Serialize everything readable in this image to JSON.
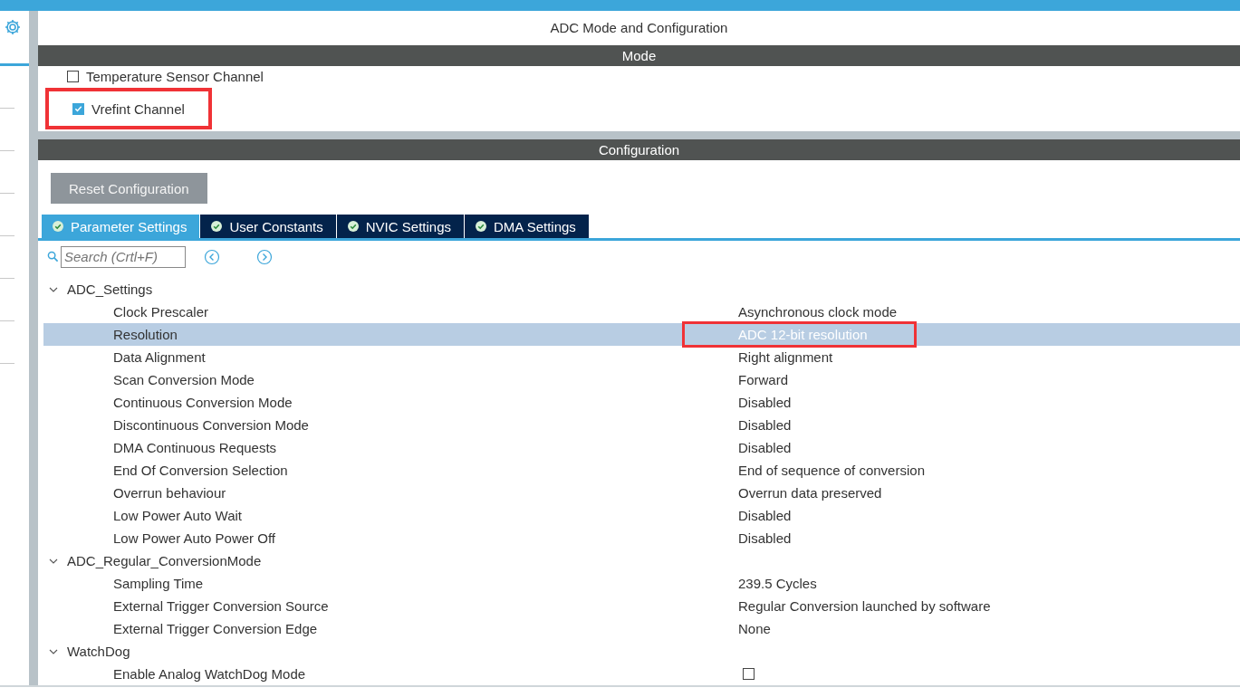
{
  "panel": {
    "title": "ADC Mode and Configuration"
  },
  "mode": {
    "header": "Mode",
    "channels": [
      {
        "label": "Temperature Sensor Channel",
        "checked": false
      },
      {
        "label": "Vrefint Channel",
        "checked": true,
        "highlighted": true
      }
    ]
  },
  "configuration": {
    "header": "Configuration",
    "reset_button": "Reset Configuration",
    "tabs": [
      {
        "label": "Parameter Settings",
        "selected": true
      },
      {
        "label": "User Constants",
        "selected": false
      },
      {
        "label": "NVIC Settings",
        "selected": false
      },
      {
        "label": "DMA Settings",
        "selected": false
      }
    ],
    "search": {
      "placeholder": "Search (Crtl+F)"
    },
    "tree": [
      {
        "label": "ADC_Settings",
        "expanded": true,
        "children": [
          {
            "label": "Clock Prescaler",
            "kind": "text",
            "value": "Asynchronous clock mode",
            "selected": false
          },
          {
            "label": "Resolution",
            "kind": "text",
            "value": "ADC 12-bit resolution",
            "selected": true,
            "highlighted": true
          },
          {
            "label": "Data Alignment",
            "kind": "text",
            "value": "Right alignment",
            "selected": false
          },
          {
            "label": "Scan Conversion Mode",
            "kind": "text",
            "value": "Forward",
            "selected": false
          },
          {
            "label": "Continuous Conversion Mode",
            "kind": "text",
            "value": "Disabled",
            "selected": false
          },
          {
            "label": "Discontinuous Conversion Mode",
            "kind": "text",
            "value": "Disabled",
            "selected": false
          },
          {
            "label": "DMA Continuous Requests",
            "kind": "text",
            "value": "Disabled",
            "selected": false
          },
          {
            "label": "End Of Conversion Selection",
            "kind": "text",
            "value": "End of sequence of conversion",
            "selected": false
          },
          {
            "label": "Overrun behaviour",
            "kind": "text",
            "value": "Overrun data preserved",
            "selected": false
          },
          {
            "label": "Low Power Auto Wait",
            "kind": "text",
            "value": "Disabled",
            "selected": false
          },
          {
            "label": "Low Power Auto Power Off",
            "kind": "text",
            "value": "Disabled",
            "selected": false
          }
        ]
      },
      {
        "label": "ADC_Regular_ConversionMode",
        "expanded": true,
        "children": [
          {
            "label": "Sampling Time",
            "kind": "text",
            "value": "239.5 Cycles",
            "selected": false
          },
          {
            "label": "External Trigger Conversion Source",
            "kind": "text",
            "value": "Regular Conversion launched by software",
            "selected": false
          },
          {
            "label": "External Trigger Conversion Edge",
            "kind": "text",
            "value": "None",
            "selected": false
          }
        ]
      },
      {
        "label": "WatchDog",
        "expanded": true,
        "children": [
          {
            "label": "Enable Analog WatchDog Mode",
            "kind": "checkbox",
            "checked": false,
            "selected": false
          }
        ]
      }
    ]
  }
}
